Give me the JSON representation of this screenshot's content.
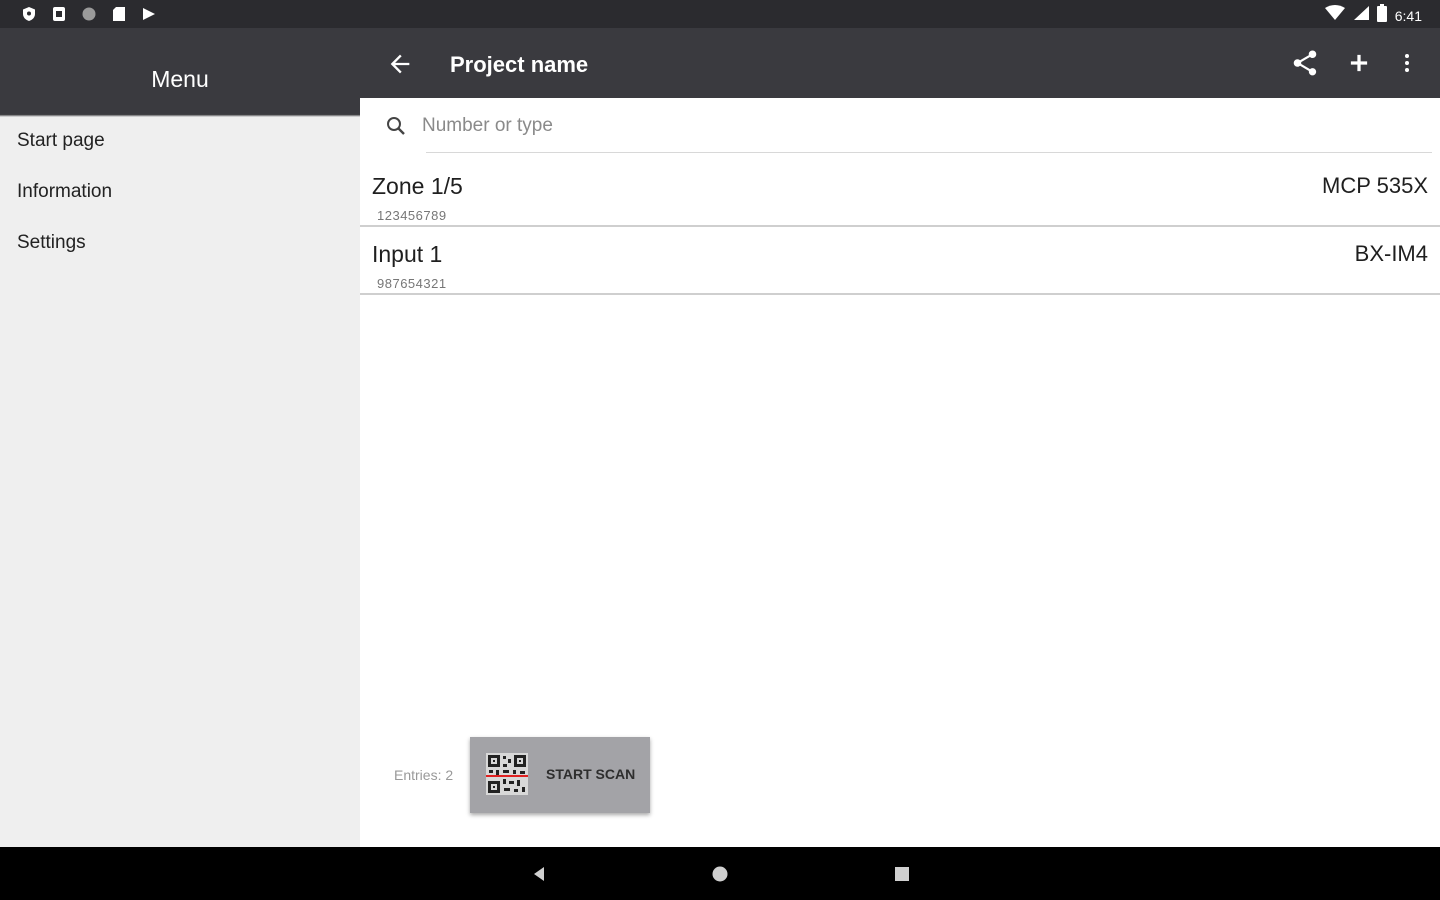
{
  "status_bar": {
    "time": "6:41",
    "left_icons": [
      "shield-icon",
      "sim-icon",
      "circle-icon",
      "sd-card-icon",
      "play-store-icon"
    ],
    "right_icons": [
      "wifi-icon",
      "signal-icon",
      "battery-icon"
    ]
  },
  "drawer": {
    "title": "Menu",
    "items": [
      {
        "label": "Start page"
      },
      {
        "label": "Information"
      },
      {
        "label": "Settings"
      }
    ]
  },
  "appbar": {
    "title": "Project name",
    "actions": [
      "share-icon",
      "add-icon",
      "more-vert-icon"
    ]
  },
  "search": {
    "placeholder": "Number or type",
    "value": ""
  },
  "list": [
    {
      "title": "Zone 1/5",
      "number": "123456789",
      "type": "MCP 535X"
    },
    {
      "title": "Input 1",
      "number": "987654321",
      "type": "BX-IM4"
    }
  ],
  "footer": {
    "entries_label": "Entries: 2",
    "scan_label": "START SCAN"
  },
  "colors": {
    "appbar": "#3a3a3f",
    "statusbar": "#2b2b2f",
    "drawer_bg": "#efefef",
    "scan_button": "#a3a3a7"
  }
}
